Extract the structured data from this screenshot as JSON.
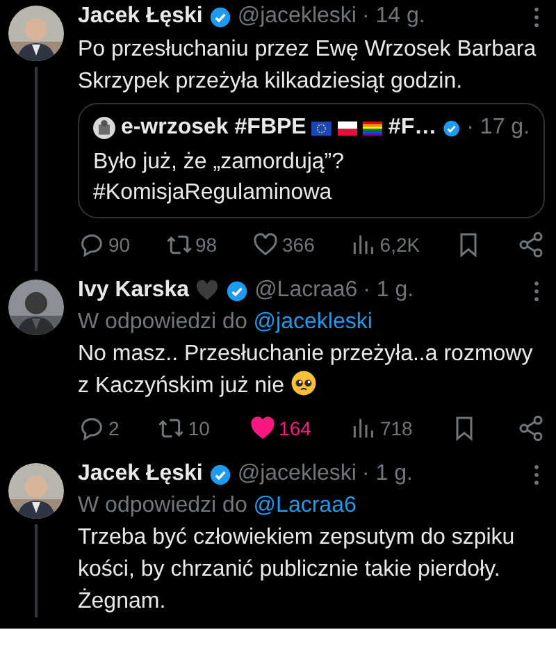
{
  "tweets": [
    {
      "name": "Jacek Łęski",
      "name_emoji": false,
      "verified": true,
      "handle": "@jacekleski",
      "time": "· 14 g.",
      "thread_line": true,
      "text": "Po przesłuchaniu przez Ewę Wrzosek Barbara Skrzypek przeżyła kilkadziesiąt godzin.",
      "text_emoji": false,
      "quote": {
        "name_start": "e-wrzosek #FBPE",
        "name_end": "#F…",
        "verified": true,
        "time": "· 17 g.",
        "text": "Było już, że „zamordują”? #KomisjaRegulaminowa"
      },
      "actions": [
        {
          "kind": "reply",
          "count": "90"
        },
        {
          "kind": "repost",
          "count": "98"
        },
        {
          "kind": "like",
          "count": "366",
          "liked": false
        },
        {
          "kind": "views",
          "count": "6,2K"
        },
        {
          "kind": "bookmark"
        },
        {
          "kind": "share"
        }
      ]
    },
    {
      "name": "Ivy Karska",
      "name_emoji": true,
      "verified": true,
      "handle": "@Lacraa6",
      "time": "· 1 g.",
      "thread_line": false,
      "reply_to": {
        "label": "W odpowiedzi do",
        "handle": "@jacekleski"
      },
      "text": "No masz.. Przesłuchanie przeżyła..a rozmowy z Kaczyńskim już nie",
      "text_emoji": true,
      "actions": [
        {
          "kind": "reply",
          "count": "2"
        },
        {
          "kind": "repost",
          "count": "10"
        },
        {
          "kind": "like",
          "count": "164",
          "liked": true
        },
        {
          "kind": "views",
          "count": "718"
        },
        {
          "kind": "bookmark"
        },
        {
          "kind": "share"
        }
      ]
    },
    {
      "name": "Jacek Łęski",
      "name_emoji": false,
      "verified": true,
      "handle": "@jacekleski",
      "time": "· 1 g.",
      "thread_line": true,
      "reply_to": {
        "label": "W odpowiedzi do",
        "handle": "@Lacraa6"
      },
      "text": "Trzeba być człowiekiem zepsutym do szpiku kości, by chrzanić publicznie takie pierdoły. Żegnam.",
      "text_emoji": false
    }
  ]
}
